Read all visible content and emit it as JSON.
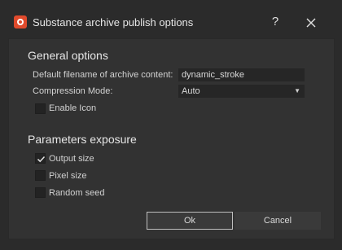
{
  "window": {
    "title": "Substance archive publish options",
    "help_label": "?"
  },
  "general": {
    "title": "General options",
    "filename_label": "Default filename of archive content:",
    "filename_value": "dynamic_stroke",
    "compression_label": "Compression Mode:",
    "compression_value": "Auto",
    "enable_icon_label": "Enable Icon",
    "enable_icon_checked": false
  },
  "parameters": {
    "title": "Parameters exposure",
    "items": [
      {
        "label": "Output size",
        "checked": true
      },
      {
        "label": "Pixel size",
        "checked": false
      },
      {
        "label": "Random seed",
        "checked": false
      }
    ]
  },
  "buttons": {
    "ok_label": "Ok",
    "cancel_label": "Cancel"
  }
}
